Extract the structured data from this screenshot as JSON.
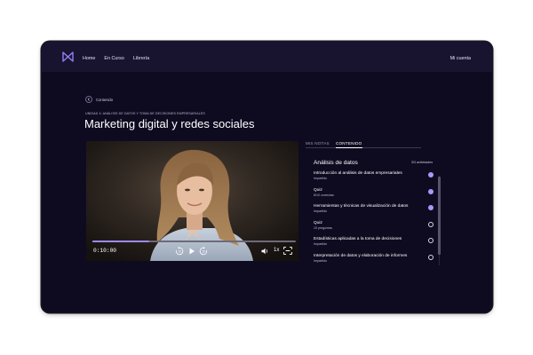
{
  "nav": {
    "items": [
      "Home",
      "En Curso",
      "Librería"
    ],
    "account": "Mi cuenta"
  },
  "breadcrumb": {
    "back_label": "Contenido"
  },
  "course": {
    "unit": "UNIDAD 4: ANÁLISIS DE DATOS Y TOMA DE DECISIONES EMPRESARIALES",
    "title": "Marketing digital y redes sociales"
  },
  "player": {
    "time": "0:10:00",
    "speed": "1x",
    "progress": 0.28
  },
  "tabs": [
    "MIS NOTAS",
    "CONTENIDO"
  ],
  "contents": {
    "heading": "Análisis de datos",
    "count": "3/3 actividades",
    "items": [
      {
        "title": "Introducción al análisis de datos empresariales",
        "subtitle": "Impartido",
        "done": true
      },
      {
        "title": "Quiz",
        "subtitle": "8/10 correctas",
        "done": true
      },
      {
        "title": "Herramientas y técnicas de visualización de datos",
        "subtitle": "Impartido",
        "done": true
      },
      {
        "title": "Quiz",
        "subtitle": "10 preguntas",
        "done": false
      },
      {
        "title": "Estadísticas aplicadas a la toma de decisiones",
        "subtitle": "Impartido",
        "done": false
      },
      {
        "title": "Interpretación de datos y elaboración de informes",
        "subtitle": "Impartido",
        "done": false
      }
    ]
  },
  "colors": {
    "background": "#0e0b21",
    "topbar": "#18142f",
    "accent": "#a79af7"
  }
}
